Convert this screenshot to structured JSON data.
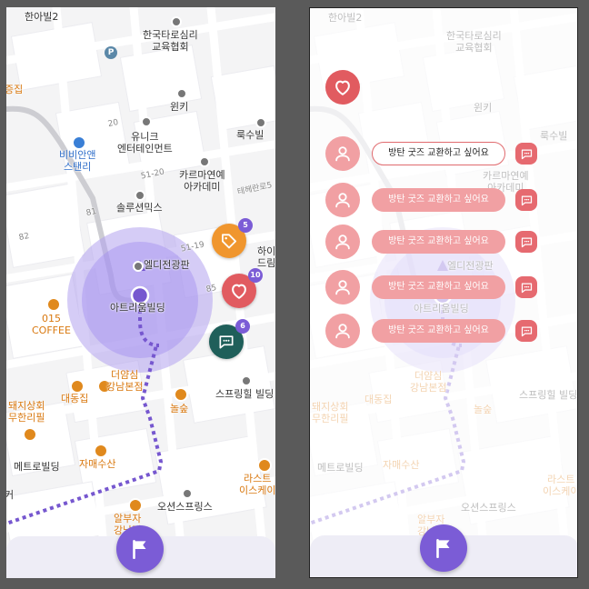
{
  "map": {
    "labels": {
      "hanabil": "한아빌2",
      "korea_tarot_1": "한국타로심리",
      "korea_tarot_2": "교육협회",
      "jeungjip": "증집",
      "winki": "윈키",
      "ruksubil": "룩수빌",
      "unique_1": "유니크",
      "unique_2": "엔터테인먼트",
      "bibian_1": "비비안앤",
      "bibian_2": "스탠리",
      "karma_1": "카르마연예",
      "karma_2": "아카데미",
      "teheran": "테헤란로5",
      "solution": "솔루션믹스",
      "num_20": "20",
      "num_51_20": "51-20",
      "num_81": "81",
      "num_82": "82",
      "num_51_19": "51-19",
      "num_85": "85",
      "haiul_1": "하이",
      "haiul_2": "드림",
      "eldi": "엘디전광판",
      "atrium": "아트리움빌딩",
      "coffee_1": "015",
      "coffee_2": "COFFEE",
      "deoksim_1": "더얌심",
      "deoksim_2": "강남본점",
      "daedong": "대동집",
      "nolsu": "놀숲",
      "spring": "스프링힐 빌딩",
      "pig_1": "돼지상회",
      "pig_2": "무한리필",
      "metro": "메트로빌딩",
      "jamae": "자매수산",
      "last_1": "라스트",
      "last_2": "이스케이",
      "ojun": "오션스프링스",
      "albuja_1": "알부자",
      "albuja_2": "강남점",
      "keo": "커"
    }
  },
  "actions": {
    "tag_count": "5",
    "heart_count": "10",
    "chat_count": "6"
  },
  "requests": [
    {
      "text": "방탄 굿즈 교환하고 싶어요"
    },
    {
      "text": "방탄 굿즈 교환하고 싶어요"
    },
    {
      "text": "방탄 굿즈 교환하고 싶어요"
    },
    {
      "text": "방탄 굿즈 교환하고 싶어요"
    },
    {
      "text": "방탄 굿즈 교환하고 싶어요"
    }
  ],
  "colors": {
    "accent": "#7b5cd6",
    "tag": "#f0962e",
    "heart": "#e15b60",
    "chat": "#1f5f5a",
    "pill": "#f1a0a3"
  },
  "icons": {
    "flag": "flag-icon",
    "tag": "tag-icon",
    "heart": "heart-icon",
    "chat": "chat-icon",
    "user": "user-icon"
  }
}
